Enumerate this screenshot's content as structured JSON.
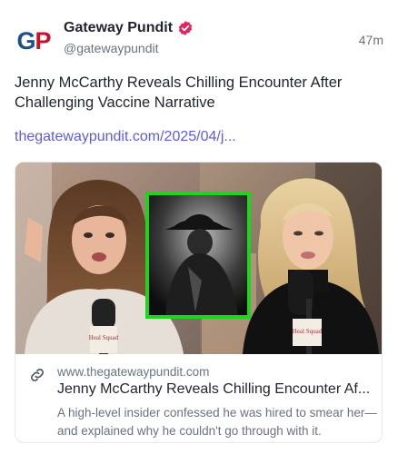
{
  "account": {
    "avatar_text": "GP",
    "name": "Gateway Pundit",
    "handle": "@gatewaypundit",
    "time": "47m",
    "verified_color": "#e0245e",
    "brand_blue": "#1f4e8c",
    "brand_red": "#c8102e"
  },
  "post": {
    "text": "Jenny McCarthy Reveals Chilling Encounter After Challenging Vaccine Narrative",
    "link": "thegatewaypundit.com/2025/04/j..."
  },
  "card": {
    "domain": "www.thegatewaypundit.com",
    "title": "Jenny McCarthy Reveals Chilling Encounter Af...",
    "description": "A high-level insider confessed he was hired to smear her—and explained why he couldn't go through with it.",
    "image": {
      "mic_label": "Heal Squad",
      "frame_color": "#1ed51e"
    }
  },
  "colors": {
    "link": "#5c5ce0",
    "muted": "#6b7280",
    "text": "#1f2430"
  }
}
